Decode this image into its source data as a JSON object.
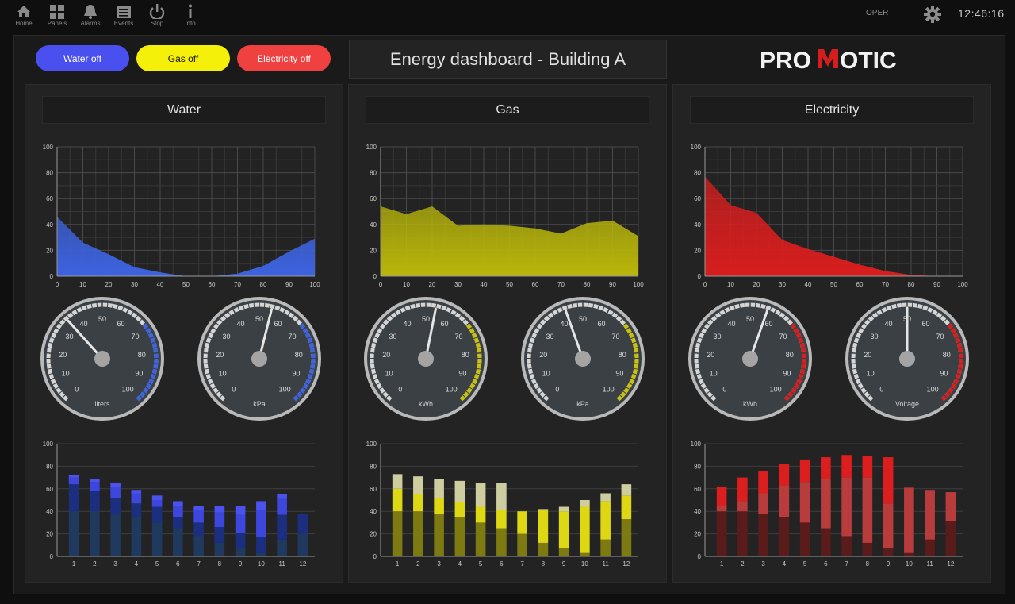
{
  "nav": [
    {
      "label": "Home",
      "icon": "home-icon"
    },
    {
      "label": "Panels",
      "icon": "panels-icon"
    },
    {
      "label": "Alarms",
      "icon": "bell-icon"
    },
    {
      "label": "Events",
      "icon": "events-icon"
    },
    {
      "label": "Stop",
      "icon": "power-icon"
    },
    {
      "label": "Info",
      "icon": "info-icon"
    }
  ],
  "status": {
    "mode": "OPER",
    "time": "12:46:16"
  },
  "buttons": [
    {
      "label": "Water off",
      "bg": "#4a50f0",
      "fg": "#ffffff"
    },
    {
      "label": "Gas off",
      "bg": "#f4f00a",
      "fg": "#111111"
    },
    {
      "label": "Electricity off",
      "bg": "#f04141",
      "fg": "#ffffff"
    }
  ],
  "dashboard_title": "Energy dashboard - Building A",
  "logo": {
    "text_left": "PRO",
    "text_right": "OTIC",
    "accent": "#d61d1d"
  },
  "panels": [
    {
      "title": "Water",
      "color": "#3d63e0",
      "gauges": [
        {
          "unit": "liters",
          "value": 35
        },
        {
          "unit": "kPa",
          "value": 55
        }
      ]
    },
    {
      "title": "Gas",
      "color": "#c8c010",
      "gauges": [
        {
          "unit": "kWh",
          "value": 54
        },
        {
          "unit": "kPa",
          "value": 43
        }
      ]
    },
    {
      "title": "Electricity",
      "color": "#d81e1e",
      "gauges": [
        {
          "unit": "kWh",
          "value": 57
        },
        {
          "unit": "Voltage",
          "value": 50
        }
      ]
    }
  ],
  "gauge_scale": [
    "0",
    "10",
    "20",
    "30",
    "40",
    "50",
    "60",
    "70",
    "80",
    "90",
    "100"
  ],
  "chart_data": [
    {
      "type": "area",
      "title": "Water",
      "x": [
        0,
        10,
        20,
        30,
        40,
        50,
        60,
        70,
        80,
        90,
        100
      ],
      "values": [
        46,
        26,
        17,
        7,
        3,
        0,
        0,
        2,
        8,
        19,
        29
      ],
      "ylim": [
        0,
        100
      ],
      "xticks": [
        "0",
        "10",
        "20",
        "30",
        "40",
        "50",
        "60",
        "70",
        "80",
        "90",
        "100"
      ],
      "yticks": [
        "0",
        "20",
        "40",
        "60",
        "80",
        "100"
      ],
      "grid": true,
      "color": "#3d63e0"
    },
    {
      "type": "area",
      "title": "Gas",
      "x": [
        0,
        10,
        20,
        30,
        40,
        50,
        60,
        70,
        80,
        90,
        100
      ],
      "values": [
        54,
        48,
        54,
        39,
        40,
        39,
        37,
        33,
        41,
        43,
        31
      ],
      "ylim": [
        0,
        100
      ],
      "xticks": [
        "0",
        "10",
        "20",
        "30",
        "40",
        "50",
        "60",
        "70",
        "80",
        "90",
        "100"
      ],
      "yticks": [
        "0",
        "20",
        "40",
        "60",
        "80",
        "100"
      ],
      "grid": true,
      "color": "#b9b60a"
    },
    {
      "type": "area",
      "title": "Electricity",
      "x": [
        0,
        10,
        20,
        30,
        40,
        50,
        60,
        70,
        80,
        90,
        100
      ],
      "values": [
        77,
        55,
        49,
        28,
        21,
        15,
        9,
        4,
        1,
        0,
        0
      ],
      "ylim": [
        0,
        100
      ],
      "xticks": [
        "0",
        "10",
        "20",
        "30",
        "40",
        "50",
        "60",
        "70",
        "80",
        "90",
        "100"
      ],
      "yticks": [
        "0",
        "20",
        "40",
        "60",
        "80",
        "100"
      ],
      "grid": true,
      "color": "#d81e1e"
    },
    {
      "type": "bar",
      "stacked": true,
      "categories": [
        "1",
        "2",
        "3",
        "4",
        "5",
        "6",
        "7",
        "8",
        "9",
        "10",
        "11",
        "12"
      ],
      "ylim": [
        0,
        100
      ],
      "yticks": [
        "0",
        "20",
        "40",
        "60",
        "80",
        "100"
      ],
      "series": [
        {
          "values": [
            40,
            40,
            38,
            35,
            30,
            25,
            18,
            12,
            7,
            3,
            15,
            20
          ],
          "color": "#1f3a5e"
        },
        {
          "values": [
            24,
            18,
            14,
            12,
            14,
            10,
            12,
            14,
            14,
            14,
            22,
            18
          ],
          "color": "#1c2e80"
        },
        {
          "values": [
            6,
            8,
            9,
            9,
            6,
            10,
            11,
            13,
            16,
            24,
            14,
            0
          ],
          "color": "#3e47dd"
        },
        {
          "values": [
            2,
            3,
            4,
            3,
            4,
            4,
            4,
            6,
            8,
            8,
            4,
            0
          ],
          "color": "#4b52f0"
        }
      ]
    },
    {
      "type": "bar",
      "stacked": true,
      "categories": [
        "1",
        "2",
        "3",
        "4",
        "5",
        "6",
        "7",
        "8",
        "9",
        "10",
        "11",
        "12"
      ],
      "ylim": [
        0,
        100
      ],
      "yticks": [
        "0",
        "20",
        "40",
        "60",
        "80",
        "100"
      ],
      "series": [
        {
          "values": [
            40,
            40,
            38,
            35,
            30,
            25,
            20,
            12,
            7,
            3,
            15,
            33
          ],
          "color": "#7c7a10"
        },
        {
          "values": [
            20,
            15,
            14,
            13,
            14,
            16,
            20,
            29,
            33,
            41,
            34,
            21
          ],
          "color": "#ddd813"
        },
        {
          "values": [
            13,
            16,
            17,
            19,
            21,
            24,
            0,
            1,
            4,
            6,
            7,
            10
          ],
          "color": "#cdcda0"
        }
      ]
    },
    {
      "type": "bar",
      "stacked": true,
      "categories": [
        "1",
        "2",
        "3",
        "4",
        "5",
        "6",
        "7",
        "8",
        "9",
        "10",
        "11",
        "12"
      ],
      "ylim": [
        0,
        100
      ],
      "yticks": [
        "0",
        "20",
        "40",
        "60",
        "80",
        "100"
      ],
      "series": [
        {
          "values": [
            40,
            40,
            38,
            35,
            30,
            25,
            18,
            12,
            7,
            3,
            15,
            31
          ],
          "color": "#5a1b1b"
        },
        {
          "values": [
            5,
            9,
            18,
            28,
            36,
            44,
            52,
            58,
            40,
            58,
            44,
            26
          ],
          "color": "#b83c3c"
        },
        {
          "values": [
            17,
            21,
            20,
            19,
            20,
            19,
            20,
            19,
            41,
            0,
            0,
            0
          ],
          "color": "#dc1e1e"
        }
      ]
    }
  ]
}
